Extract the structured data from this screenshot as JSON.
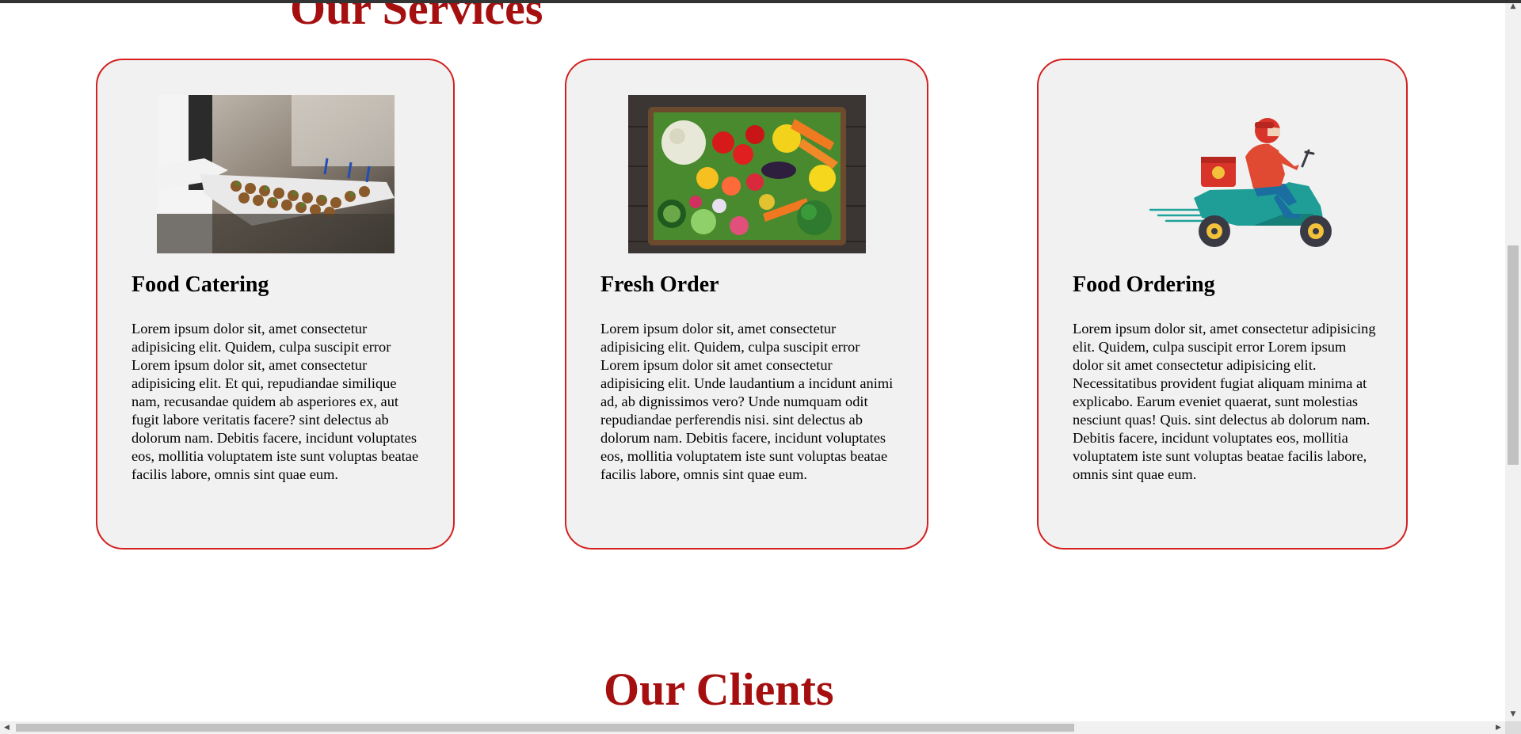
{
  "services": {
    "title": "Our Services",
    "cards": [
      {
        "heading": "Food Catering",
        "image_alt": "waiter-holding-catering-tray-photo",
        "text": "Lorem ipsum dolor sit, amet consectetur adipisicing elit. Quidem, culpa suscipit error Lorem ipsum dolor sit, amet consectetur adipisicing elit. Et qui, repudiandae similique nam, recusandae quidem ab asperiores ex, aut fugit labore veritatis facere? sint delectus ab dolorum nam. Debitis facere, incidunt voluptates eos, mollitia voluptatem iste sunt voluptas beatae facilis labore, omnis sint quae eum."
      },
      {
        "heading": "Fresh Order",
        "image_alt": "crate-of-fresh-vegetables-photo",
        "text": "Lorem ipsum dolor sit, amet consectetur adipisicing elit. Quidem, culpa suscipit error Lorem ipsum dolor sit amet consectetur adipisicing elit. Unde laudantium a incidunt animi ad, ab dignissimos vero? Unde numquam odit repudiandae perferendis nisi. sint delectus ab dolorum nam. Debitis facere, incidunt voluptates eos, mollitia voluptatem iste sunt voluptas beatae facilis labore, omnis sint quae eum."
      },
      {
        "heading": "Food Ordering",
        "image_alt": "delivery-scooter-illustration",
        "text": "Lorem ipsum dolor sit, amet consectetur adipisicing elit. Quidem, culpa suscipit error Lorem ipsum dolor sit amet consectetur adipisicing elit. Necessitatibus provident fugiat aliquam minima at explicabo. Earum eveniet quaerat, sunt molestias nesciunt quas! Quis. sint delectus ab dolorum nam. Debitis facere, incidunt voluptates eos, mollitia voluptatem iste sunt voluptas beatae facilis labore, omnis sint quae eum."
      }
    ]
  },
  "clients": {
    "title": "Our Clients"
  },
  "colors": {
    "title_red": "#a50f0f",
    "card_border": "#d42020",
    "card_bg": "#f1f1f1"
  },
  "scrollbars": {
    "up_arrow_icon": "▲",
    "down_arrow_icon": "▼",
    "left_arrow_icon": "◀",
    "right_arrow_icon": "▶"
  }
}
